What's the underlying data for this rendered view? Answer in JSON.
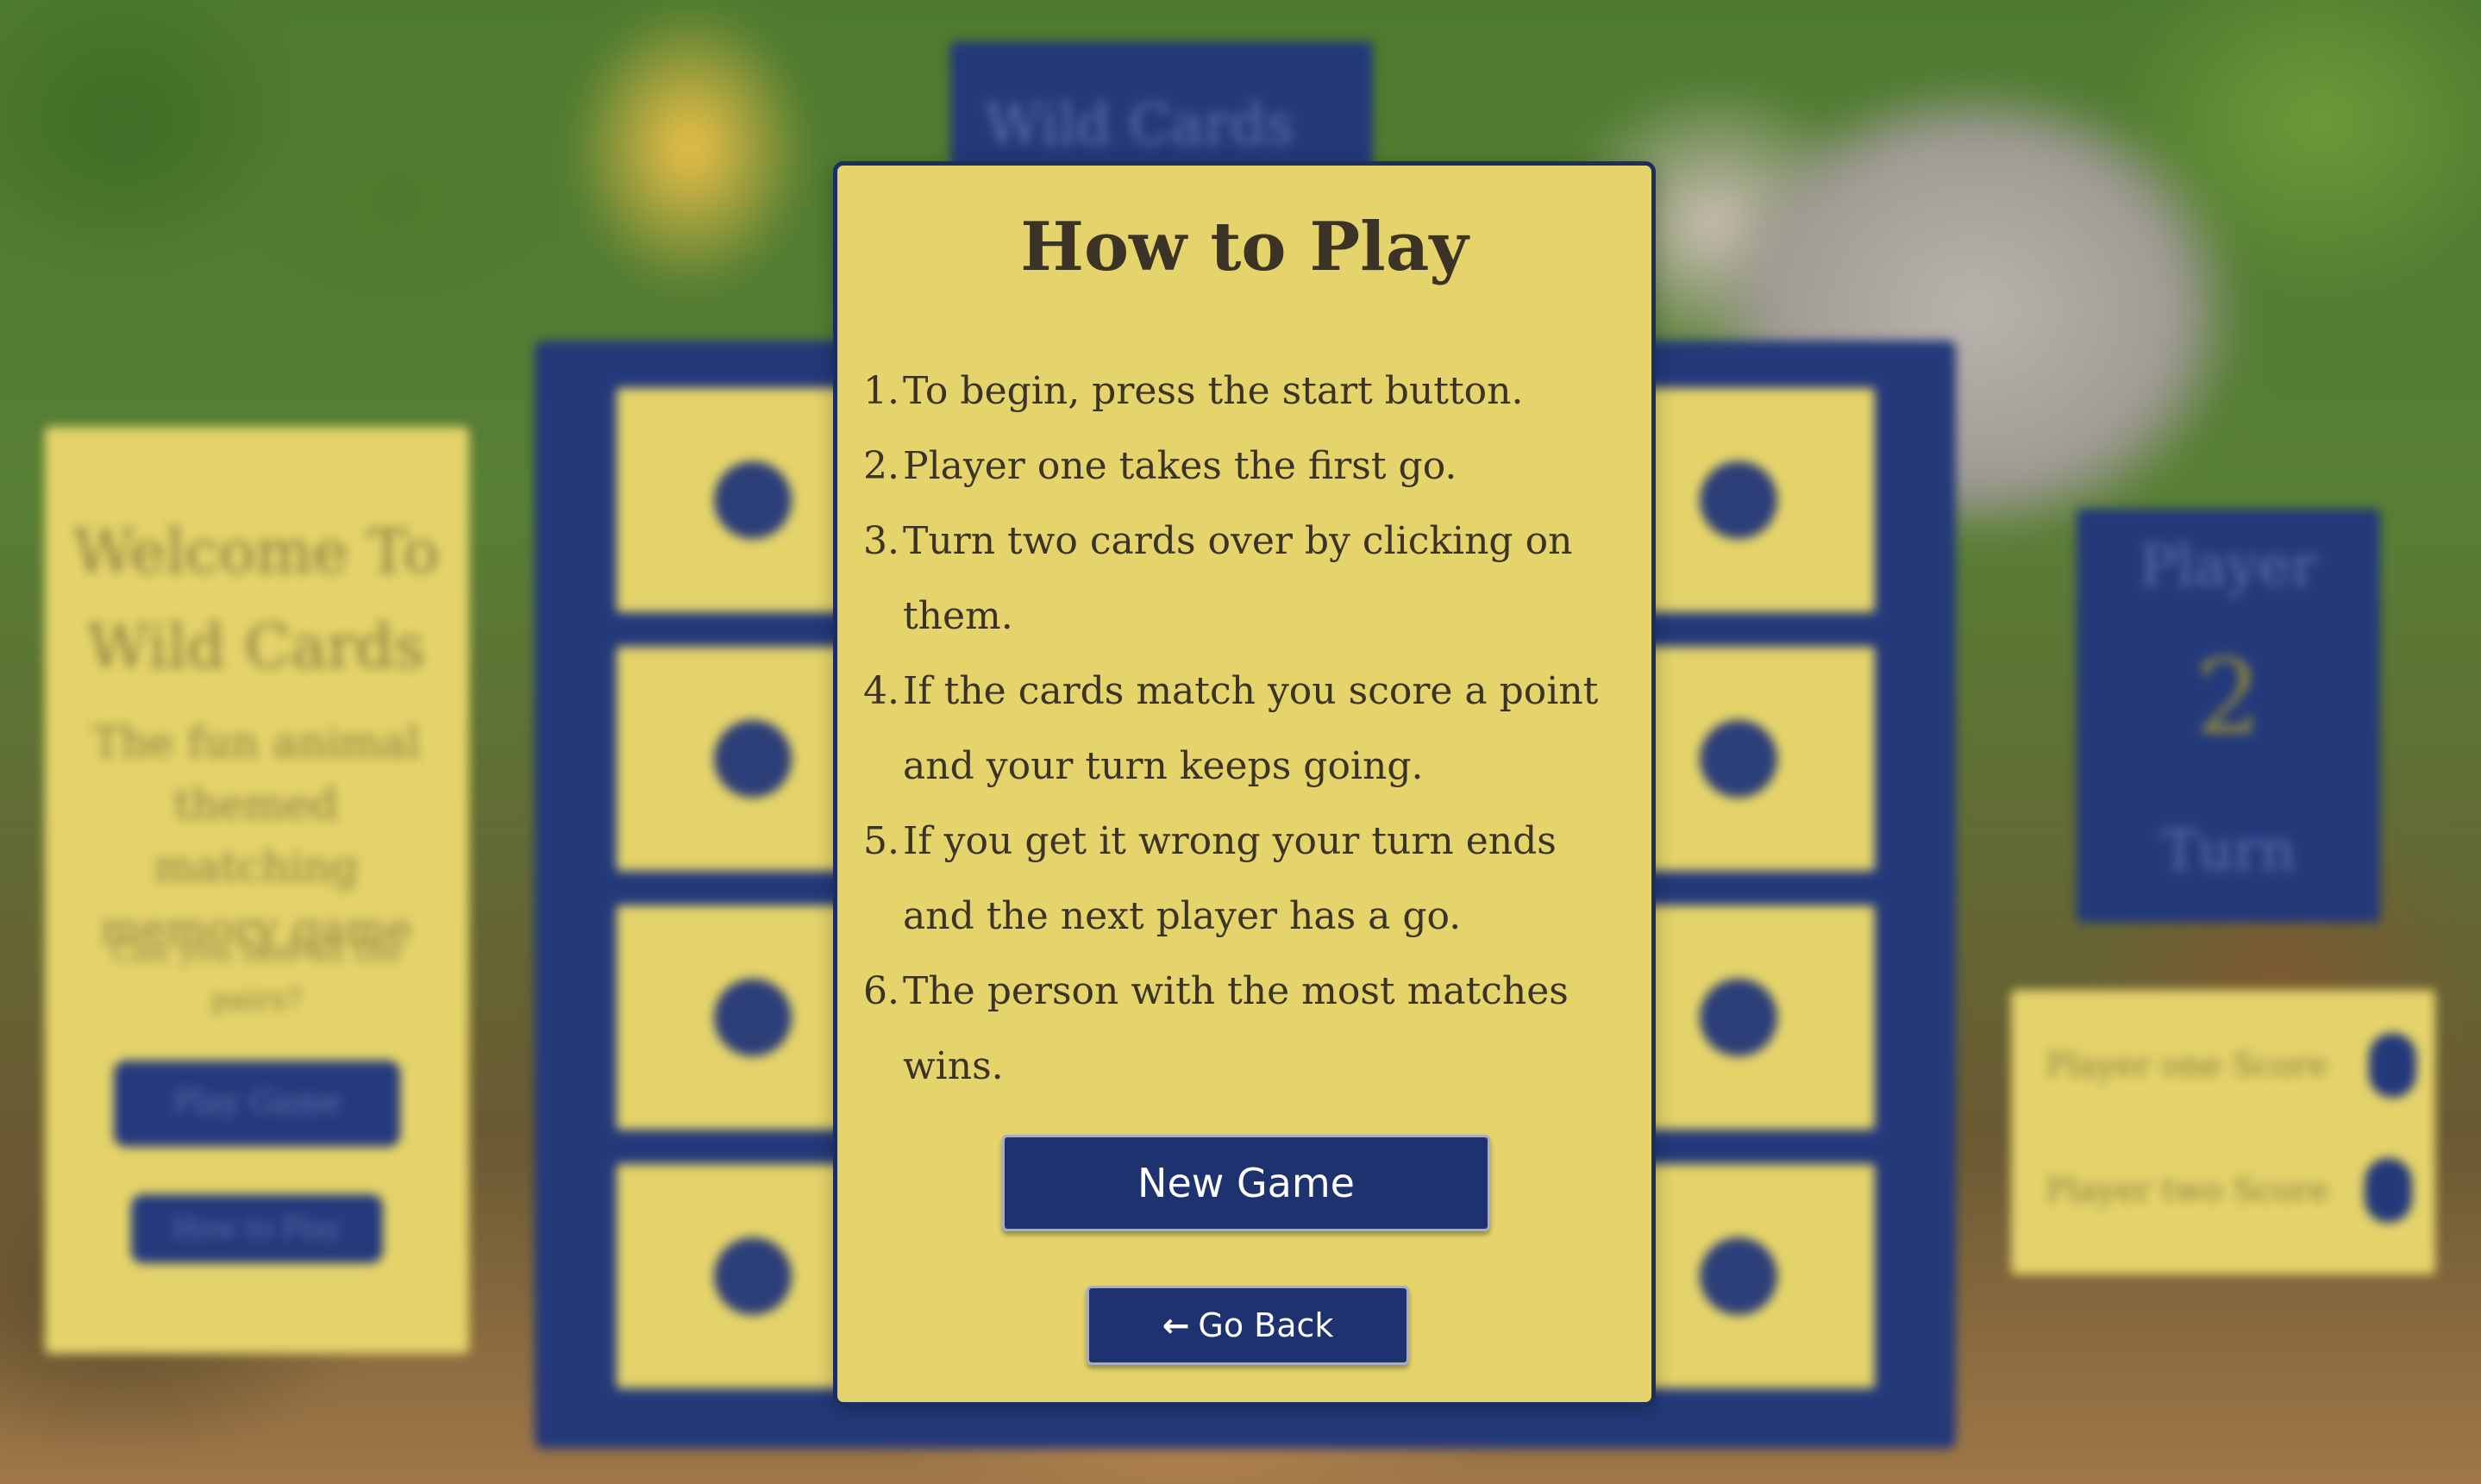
{
  "background": {
    "title_tab_text": "Wild Cards",
    "welcome_panel": {
      "title": "Welcome To Wild Cards",
      "description": "The fun animal themed matching memory game",
      "sub_text": "Can you find all the pairs?",
      "buttons": [
        "Play Game",
        "How to Play"
      ]
    },
    "turn_panel": {
      "label_top": "Player",
      "number": "2",
      "label_bottom": "Turn"
    },
    "scores": [
      "Player one Score",
      "Player two Score"
    ],
    "card_icon": "paw-icon"
  },
  "modal": {
    "title": "How to Play",
    "steps": [
      {
        "num": "1.",
        "text": "To begin, press the start button."
      },
      {
        "num": "2.",
        "text": "Player one takes the first go."
      },
      {
        "num": "3.",
        "text": "Turn two cards over by clicking on them."
      },
      {
        "num": "4.",
        "text": "If the cards match you score a point and your turn keeps going."
      },
      {
        "num": "5.",
        "text": "If you get it wrong your turn ends and the next player has a go."
      },
      {
        "num": "6.",
        "text": "The person with the most matches wins."
      }
    ],
    "new_game_label": "New Game",
    "go_back_label": "Go Back",
    "go_back_icon": "arrow-left-icon"
  },
  "colors": {
    "panel_yellow": "#e5d36c",
    "navy": "#1f3270",
    "text_dark": "#3b3326"
  }
}
